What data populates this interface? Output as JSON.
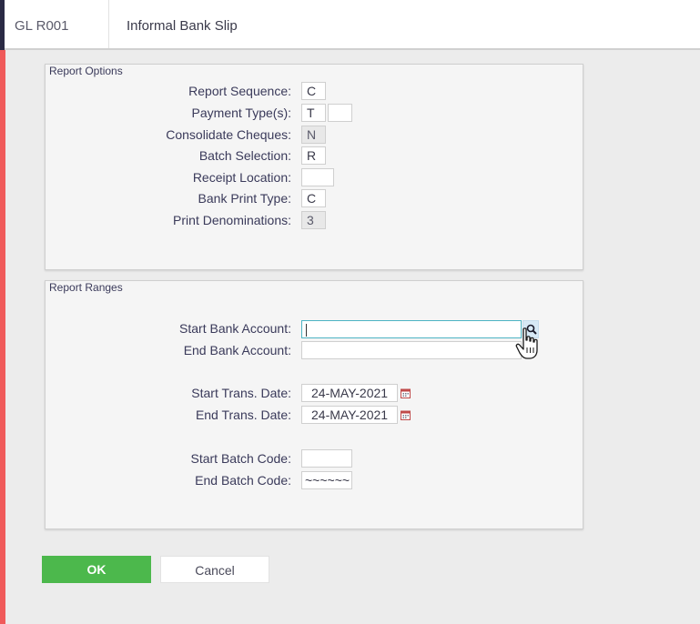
{
  "header": {
    "code": "GL R001",
    "title": "Informal Bank Slip"
  },
  "report_options": {
    "title": "Report Options",
    "report_sequence": {
      "label": "Report Sequence:",
      "value": "C"
    },
    "payment_types": {
      "label": "Payment Type(s):",
      "value1": "T",
      "value2": ""
    },
    "consolidate_cheques": {
      "label": "Consolidate Cheques:",
      "value": "N"
    },
    "batch_selection": {
      "label": "Batch Selection:",
      "value": "R"
    },
    "receipt_location": {
      "label": "Receipt Location:",
      "value": ""
    },
    "bank_print_type": {
      "label": "Bank Print Type:",
      "value": "C"
    },
    "print_denominations": {
      "label": "Print Denominations:",
      "value": "3"
    }
  },
  "report_ranges": {
    "title": "Report Ranges",
    "start_bank_account": {
      "label": "Start Bank Account:",
      "value": ""
    },
    "end_bank_account": {
      "label": "End Bank Account:",
      "value": ""
    },
    "start_trans_date": {
      "label": "Start Trans. Date:",
      "value": "24-MAY-2021"
    },
    "end_trans_date": {
      "label": "End Trans. Date:",
      "value": "24-MAY-2021"
    },
    "start_batch_code": {
      "label": "Start Batch Code:",
      "value": ""
    },
    "end_batch_code": {
      "label": "End Batch Code:",
      "value": "~~~~~~"
    }
  },
  "buttons": {
    "ok": "OK",
    "cancel": "Cancel"
  },
  "icons": {
    "lookup": "search-icon",
    "calendar": "calendar-icon",
    "cursor": "hand-pointer-icon"
  },
  "colors": {
    "accent_left": "#f05a5a",
    "ok_button": "#4cb84c",
    "focus_border": "#4cb4c4"
  }
}
